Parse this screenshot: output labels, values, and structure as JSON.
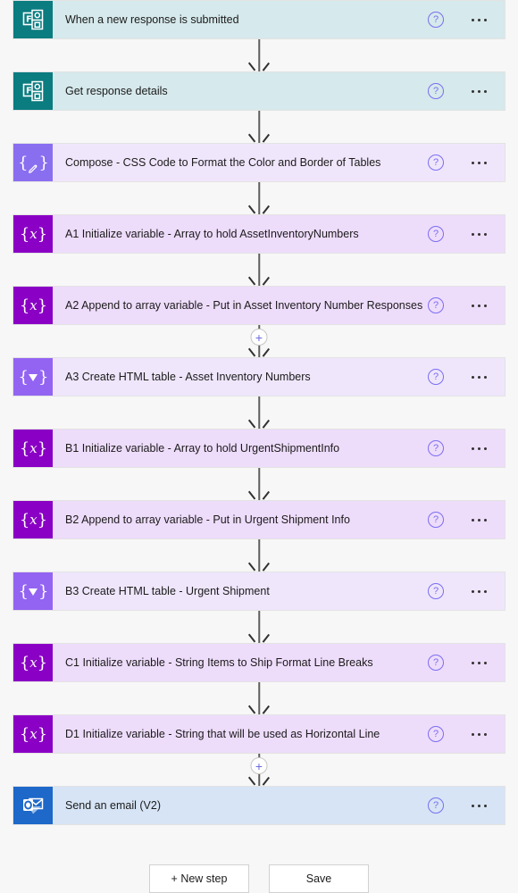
{
  "canvas": {
    "background_color": "#f7f7f7"
  },
  "colors": {
    "forms_icon": "#0b7c80",
    "forms_body": "#d6e9ec",
    "outlook_icon": "#1d68c8",
    "outlook_body": "#d6e4f5",
    "compose_icon": "#8a6ef0",
    "compose_body": "#f0e6fc",
    "variable_icon": "#8a00c4",
    "variable_body": "#eedcfb",
    "table_icon": "#9364f2",
    "table_body": "#efe6fc",
    "connector_line": "#605e5c",
    "plus_accent": "#6a6ae0",
    "help_accent": "#7a6ff0"
  },
  "common": {
    "help_glyph": "?",
    "help_icon_name": "help-icon",
    "more_icon_name": "more-options-icon",
    "plus_glyph": "+"
  },
  "steps": [
    {
      "title": "When a new response is submitted",
      "theme": "forms",
      "icon": "microsoft-forms-icon",
      "connector_after": {
        "type": "arrow"
      }
    },
    {
      "title": "Get response details",
      "theme": "forms",
      "icon": "microsoft-forms-icon",
      "connector_after": {
        "type": "arrow"
      }
    },
    {
      "title": "Compose - CSS Code to Format the Color and Border of Tables",
      "theme": "compose",
      "icon": "compose-icon",
      "connector_after": {
        "type": "arrow"
      }
    },
    {
      "title": "A1 Initialize variable - Array to hold AssetInventoryNumbers",
      "theme": "variable",
      "icon": "variable-icon",
      "connector_after": {
        "type": "arrow"
      }
    },
    {
      "title": "A2 Append to array variable - Put in Asset Inventory Number Responses",
      "theme": "variable",
      "icon": "variable-icon",
      "connector_after": {
        "type": "arrow-with-plus"
      }
    },
    {
      "title": "A3 Create HTML table - Asset Inventory Numbers",
      "theme": "table",
      "icon": "create-html-table-icon",
      "connector_after": {
        "type": "arrow"
      }
    },
    {
      "title": "B1 Initialize variable - Array to hold UrgentShipmentInfo",
      "theme": "variable",
      "icon": "variable-icon",
      "connector_after": {
        "type": "arrow"
      }
    },
    {
      "title": "B2 Append to array variable - Put in Urgent Shipment Info",
      "theme": "variable",
      "icon": "variable-icon",
      "connector_after": {
        "type": "arrow"
      }
    },
    {
      "title": "B3 Create HTML table - Urgent Shipment",
      "theme": "table",
      "icon": "create-html-table-icon",
      "connector_after": {
        "type": "arrow"
      }
    },
    {
      "title": "C1 Initialize variable - String Items to Ship Format Line Breaks",
      "theme": "variable",
      "icon": "variable-icon",
      "connector_after": {
        "type": "arrow"
      }
    },
    {
      "title": "D1 Initialize variable - String that will be used as Horizontal Line",
      "theme": "variable",
      "icon": "variable-icon",
      "connector_after": {
        "type": "arrow-with-plus"
      }
    },
    {
      "title": "Send an email (V2)",
      "theme": "outlook",
      "icon": "outlook-icon",
      "connector_after": null
    }
  ],
  "footer": {
    "new_step_label": "+ New step",
    "save_label": "Save"
  }
}
